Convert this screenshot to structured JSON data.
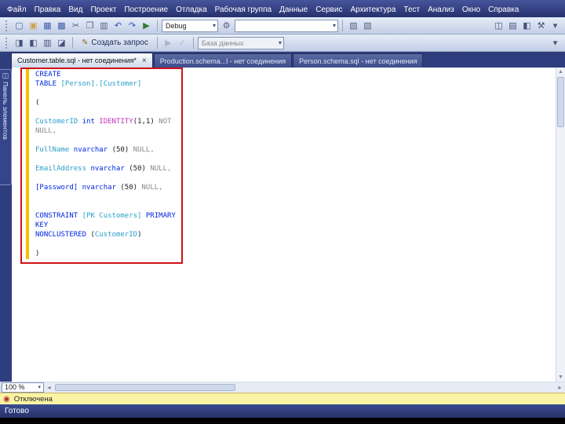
{
  "colors": {
    "kw": "#0026e0",
    "id": "#2a9fc9",
    "fn": "#c431b9",
    "gy": "#8a8a8a",
    "pl": "#1a1a1a",
    "ann": "#d01216",
    "changebar": "#f2c200",
    "connbar": "#faf3a3"
  },
  "menu": {
    "items": [
      "Файл",
      "Правка",
      "Вид",
      "Проект",
      "Построение",
      "Отладка",
      "Рабочая группа",
      "Данные",
      "Сервис",
      "Архитектура",
      "Тест",
      "Анализ",
      "Окно",
      "Справка"
    ]
  },
  "toolbar1": {
    "debug_value": "Debug",
    "group1": [
      {
        "name": "new-file-icon",
        "glyph": "▢",
        "color": "#3e5fa5"
      },
      {
        "name": "open-folder-icon",
        "glyph": "▣",
        "color": "#caa24e"
      },
      {
        "name": "save-icon",
        "glyph": "▦",
        "color": "#3e5fa5"
      },
      {
        "name": "save-all-icon",
        "glyph": "▩",
        "color": "#3e5fa5"
      },
      {
        "name": "cut-icon",
        "glyph": "✂",
        "color": "#55607f"
      },
      {
        "name": "copy-icon",
        "glyph": "❐",
        "color": "#55607f"
      },
      {
        "name": "paste-icon",
        "glyph": "▥",
        "color": "#55607f"
      },
      {
        "name": "undo-icon",
        "glyph": "↶",
        "color": "#2a52c0"
      },
      {
        "name": "redo-icon",
        "glyph": "↷",
        "color": "#2a52c0"
      },
      {
        "name": "start-debug-icon",
        "glyph": "▶",
        "color": "#2f7d33"
      }
    ],
    "group2": [
      {
        "name": "build-settings-icon",
        "glyph": "⚙",
        "color": "#55607f"
      }
    ],
    "group3": [
      {
        "name": "find-in-files-icon",
        "glyph": "▧",
        "color": "#55607f"
      },
      {
        "name": "navigate-back-icon",
        "glyph": "▨",
        "color": "#55607f"
      }
    ],
    "group_right": [
      {
        "name": "solution-explorer-icon",
        "glyph": "◫",
        "color": "#44527a"
      },
      {
        "name": "properties-window-icon",
        "glyph": "▤",
        "color": "#44527a"
      },
      {
        "name": "object-browser-icon",
        "glyph": "◧",
        "color": "#44527a"
      },
      {
        "name": "toolbox-icon",
        "glyph": "⚒",
        "color": "#44527a"
      },
      {
        "name": "overflow-chevron-icon",
        "glyph": "▾",
        "color": "#44527a"
      }
    ]
  },
  "toolbar2": {
    "group1": [
      {
        "name": "schema-compare-icon",
        "glyph": "◨",
        "color": "#44527a"
      },
      {
        "name": "data-compare-icon",
        "glyph": "◧",
        "color": "#44527a"
      },
      {
        "name": "tsql-editor-icon",
        "glyph": "▥",
        "color": "#44527a"
      },
      {
        "name": "database-project-icon",
        "glyph": "◪",
        "color": "#44527a"
      }
    ],
    "new_query": {
      "glyph": "✎",
      "label": "Создать запрос"
    },
    "group2": [
      {
        "name": "execute-sql-icon",
        "glyph": "▶",
        "color": "#6c7a9c",
        "disabled": true
      },
      {
        "name": "validate-syntax-icon",
        "glyph": "✓",
        "color": "#6c7a9c",
        "disabled": true
      }
    ],
    "database_value": "База данных",
    "group_right": [
      {
        "name": "overflow-chevron-icon",
        "glyph": "▾",
        "color": "#44527a"
      }
    ]
  },
  "tabs": [
    {
      "label": "Customer.table.sql - нет соединения*",
      "active": true,
      "closable": true
    },
    {
      "label": "Production.schema...l - нет соединения",
      "active": false,
      "closable": false
    },
    {
      "label": "Person.schema.sql - нет соединения",
      "active": false,
      "closable": false
    }
  ],
  "side_tab": {
    "label": "Панель элементов"
  },
  "editor": {
    "lines": [
      [
        {
          "t": "CREATE",
          "c": "kw"
        }
      ],
      [
        {
          "t": "TABLE ",
          "c": "kw"
        },
        {
          "t": "[Person].[Customer]",
          "c": "id"
        }
      ],
      [],
      [
        {
          "t": "(",
          "c": "pl"
        }
      ],
      [],
      [
        {
          "t": "CustomerID ",
          "c": "id"
        },
        {
          "t": "int ",
          "c": "kw"
        },
        {
          "t": "IDENTITY",
          "c": "fn"
        },
        {
          "t": "(1,1)",
          "c": "pl"
        },
        {
          "t": " NOT",
          "c": "gy"
        }
      ],
      [
        {
          "t": "NULL,",
          "c": "gy"
        }
      ],
      [],
      [
        {
          "t": "FullName ",
          "c": "id"
        },
        {
          "t": "nvarchar ",
          "c": "kw"
        },
        {
          "t": "(50)",
          "c": "pl"
        },
        {
          "t": " NULL,",
          "c": "gy"
        }
      ],
      [],
      [
        {
          "t": "EmailAddress ",
          "c": "id"
        },
        {
          "t": "nvarchar ",
          "c": "kw"
        },
        {
          "t": "(50)",
          "c": "pl"
        },
        {
          "t": " NULL,",
          "c": "gy"
        }
      ],
      [],
      [
        {
          "t": "[Password] ",
          "c": "kw"
        },
        {
          "t": "nvarchar ",
          "c": "kw"
        },
        {
          "t": "(50)",
          "c": "pl"
        },
        {
          "t": " NULL,",
          "c": "gy"
        }
      ],
      [],
      [],
      [
        {
          "t": "CONSTRAINT ",
          "c": "kw"
        },
        {
          "t": "[PK Customers] ",
          "c": "id"
        },
        {
          "t": "PRIMARY",
          "c": "kw"
        }
      ],
      [
        {
          "t": "KEY",
          "c": "kw"
        }
      ],
      [
        {
          "t": "NONCLUSTERED ",
          "c": "kw"
        },
        {
          "t": "(",
          "c": "pl"
        },
        {
          "t": "CustomerID",
          "c": "id"
        },
        {
          "t": ")",
          "c": "pl"
        }
      ],
      [],
      [
        {
          "t": ")",
          "c": "pl"
        }
      ]
    ]
  },
  "statusbar": {
    "zoom": "100 %",
    "connection": "Отключена",
    "ready": "Готово"
  }
}
